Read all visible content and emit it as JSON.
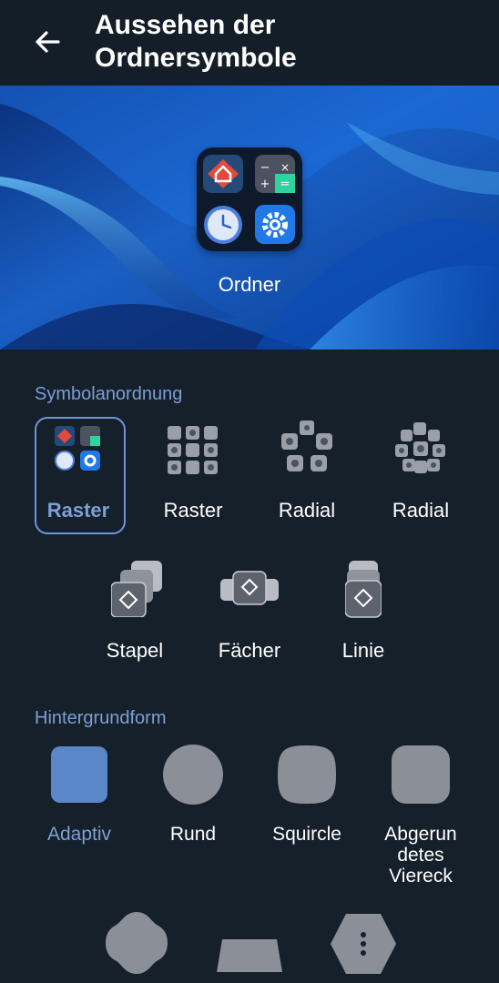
{
  "header": {
    "title_line1": "Aussehen der",
    "title_line2": "Ordnersymbole",
    "back_icon": "arrow-left-icon"
  },
  "preview": {
    "folder_label": "Ordner",
    "folder_icons": [
      "nova-launcher-icon",
      "calculator-icon",
      "clock-icon",
      "settings-gear-icon"
    ]
  },
  "arrangement": {
    "label": "Symbolanordnung",
    "options": [
      {
        "label": "Raster",
        "selected": true
      },
      {
        "label": "Raster",
        "selected": false
      },
      {
        "label": "Radial",
        "selected": false
      },
      {
        "label": "Radial",
        "selected": false
      },
      {
        "label": "Stapel",
        "selected": false
      },
      {
        "label": "Fächer",
        "selected": false
      },
      {
        "label": "Linie",
        "selected": false
      }
    ]
  },
  "background_shape": {
    "label": "Hintergrundform",
    "options": [
      {
        "label": "Adaptiv",
        "selected": true
      },
      {
        "label": "Rund",
        "selected": false
      },
      {
        "label": "Squircle",
        "selected": false
      },
      {
        "label_line1": "Abgerun",
        "label_line2": "detes",
        "label_line3": "Viereck",
        "selected": false
      }
    ]
  },
  "colors": {
    "background": "#15202b",
    "accent": "#6f95d6",
    "shape_selected": "#5b86c8",
    "shape_default": "#8b8f98"
  }
}
